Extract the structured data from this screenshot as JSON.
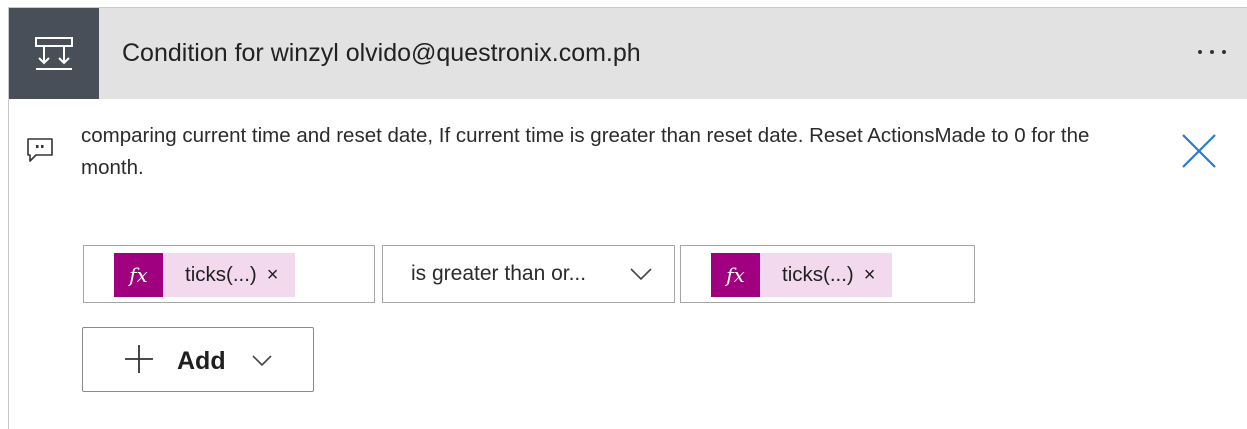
{
  "header": {
    "title": "Condition for winzyl olvido@questronix.com.ph",
    "icon": "condition-icon",
    "more_icon": "more-options-icon",
    "accent_color": "#484f58"
  },
  "comment": {
    "icon": "comment-icon",
    "text": "comparing current time and reset date, If current time is greater than reset date. Reset ActionsMade to 0 for the month.",
    "close_icon": "close-icon"
  },
  "condition": {
    "left_operand": {
      "badge": "fx",
      "label": "ticks(...)",
      "remove": "×"
    },
    "operator": {
      "selected": "is greater than or...",
      "icon": "chevron-down-icon"
    },
    "right_operand": {
      "badge": "fx",
      "label": "ticks(...)",
      "remove": "×"
    },
    "token_color": "#a0007f",
    "token_bg": "#f2d9ee"
  },
  "add_button": {
    "label": "Add",
    "plus_icon": "plus-icon",
    "chevron_icon": "chevron-down-icon"
  }
}
